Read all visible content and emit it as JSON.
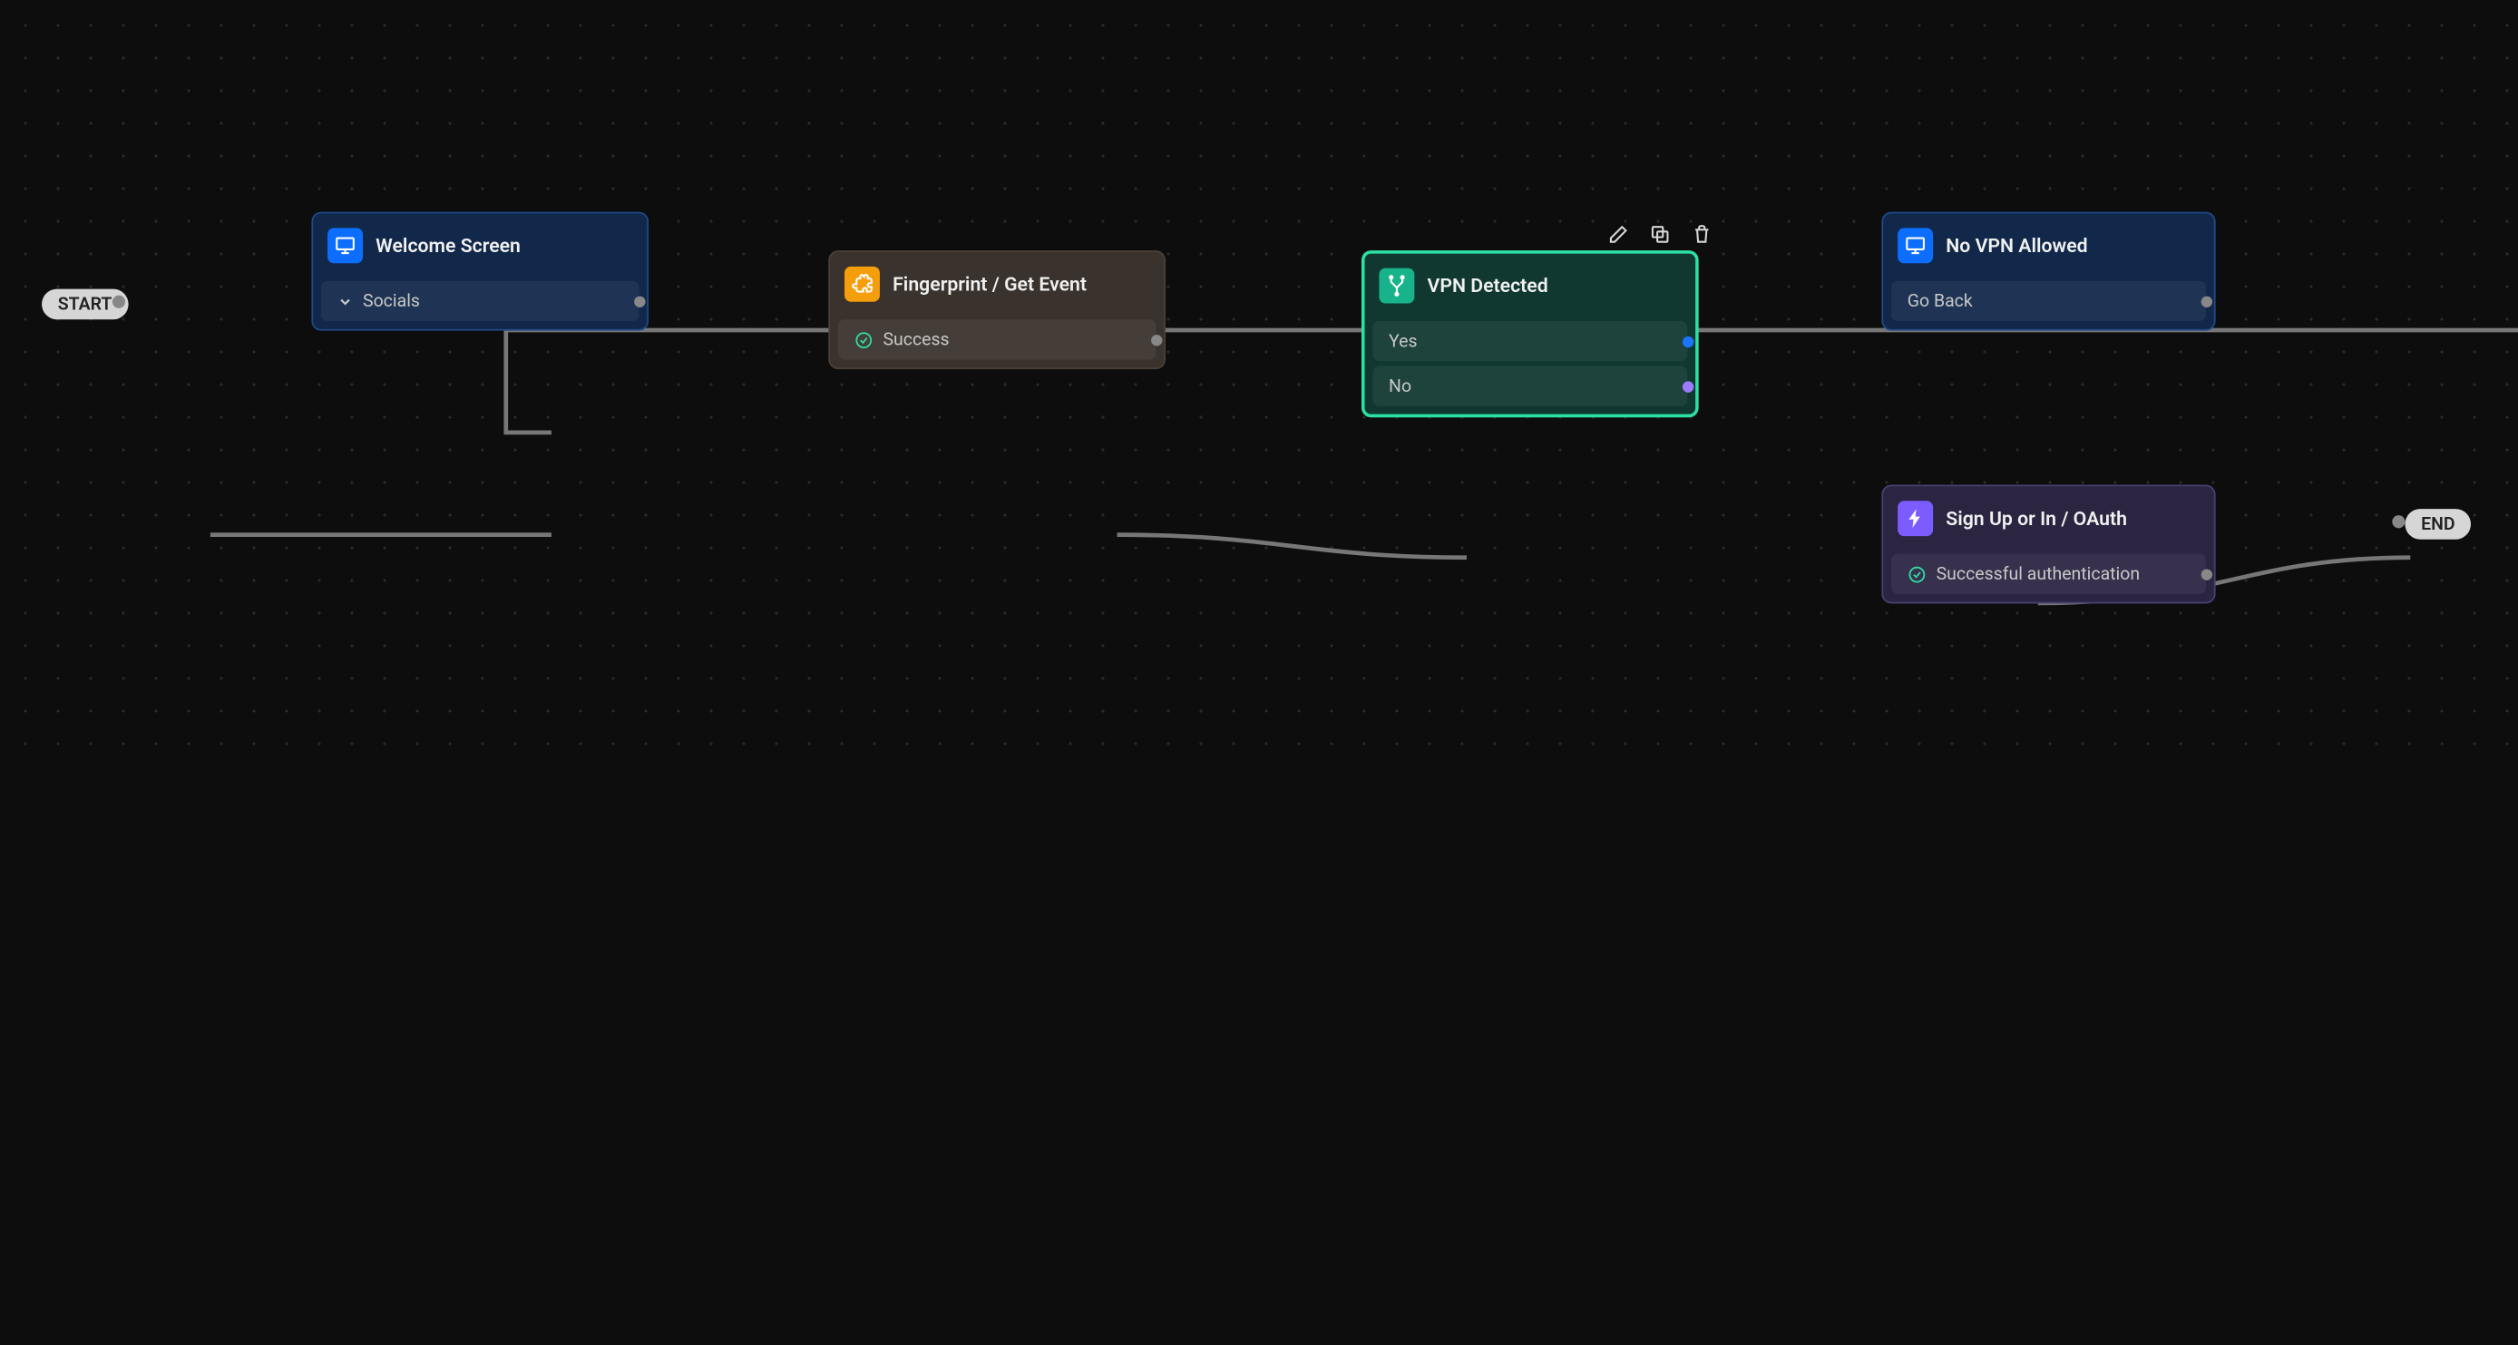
{
  "terminals": {
    "start": "START",
    "end": "END"
  },
  "nodes": {
    "welcome": {
      "title": "Welcome Screen",
      "rows": {
        "socials": "Socials"
      }
    },
    "fingerprint": {
      "title": "Fingerprint / Get Event",
      "rows": {
        "success": "Success"
      }
    },
    "vpn": {
      "title": "VPN Detected",
      "rows": {
        "yes": "Yes",
        "no": "No"
      }
    },
    "novpn": {
      "title": "No VPN Allowed",
      "rows": {
        "goback": "Go Back"
      }
    },
    "signup": {
      "title": "Sign Up or In / OAuth",
      "rows": {
        "ok": "Successful authentication"
      }
    }
  }
}
